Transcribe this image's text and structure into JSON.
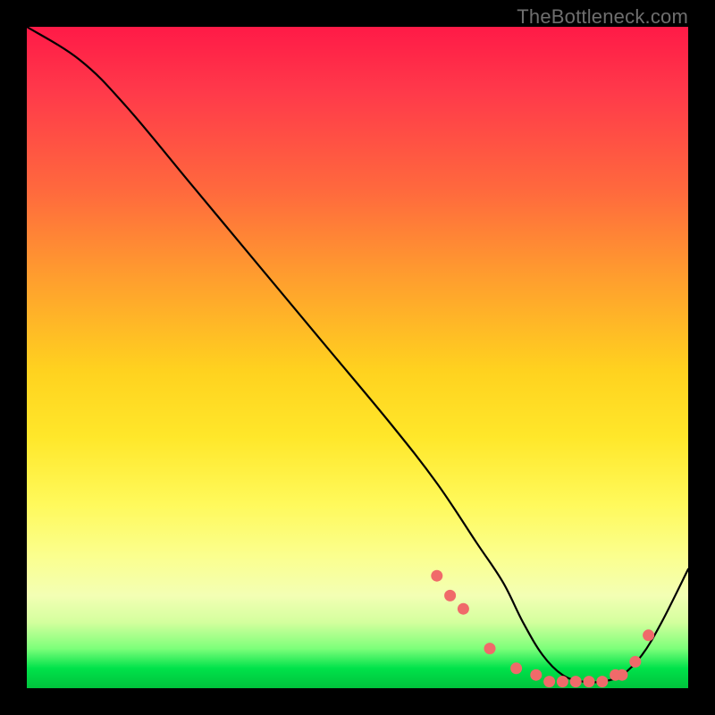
{
  "watermark": "TheBottleneck.com",
  "chart_data": {
    "type": "line",
    "title": "",
    "xlabel": "",
    "ylabel": "",
    "xlim": [
      0,
      100
    ],
    "ylim": [
      0,
      100
    ],
    "series": [
      {
        "name": "bottleneck-curve",
        "x": [
          0,
          8,
          15,
          25,
          35,
          45,
          55,
          62,
          68,
          72,
          75,
          78,
          81,
          84,
          87,
          90,
          93,
          96,
          100
        ],
        "values": [
          100,
          95,
          88,
          76,
          64,
          52,
          40,
          31,
          22,
          16,
          10,
          5,
          2,
          1,
          1,
          2,
          5,
          10,
          18
        ]
      }
    ],
    "markers": {
      "name": "highlighted-points",
      "color": "#f06a6a",
      "x": [
        62,
        64,
        66,
        70,
        74,
        77,
        79,
        81,
        83,
        85,
        87,
        89,
        90,
        92,
        94
      ],
      "values": [
        17,
        14,
        12,
        6,
        3,
        2,
        1,
        1,
        1,
        1,
        1,
        2,
        2,
        4,
        8
      ]
    }
  }
}
